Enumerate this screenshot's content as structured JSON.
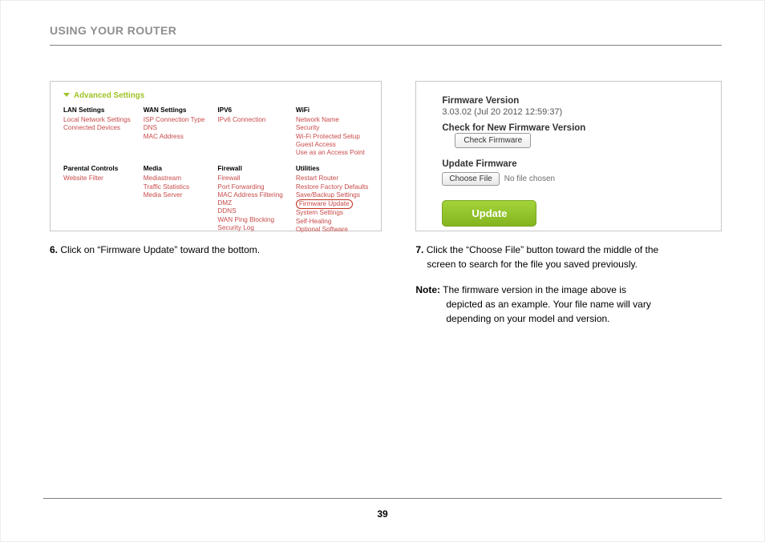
{
  "page": {
    "title": "USING YOUR ROUTER",
    "number": "39"
  },
  "shot1": {
    "title": "Advanced Settings",
    "cols": [
      {
        "head": "LAN Settings",
        "items": [
          "Local Network Settings",
          "Connected Devices"
        ]
      },
      {
        "head": "WAN Settings",
        "items": [
          "ISP Connection Type",
          "DNS",
          "MAC Address"
        ]
      },
      {
        "head": "IPV6",
        "items": [
          "IPv6 Connection"
        ]
      },
      {
        "head": "WiFi",
        "items": [
          "Network Name",
          "Security",
          "Wi-Fi Protected Setup",
          "Guest Access",
          "Use as an Access Point"
        ]
      },
      {
        "head": "Parental Controls",
        "items": [
          "Website Filter"
        ]
      },
      {
        "head": "Media",
        "items": [
          "Mediastream",
          "Traffic Statistics",
          "Media Server"
        ]
      },
      {
        "head": "Firewall",
        "items": [
          "Firewall",
          "Port Forwarding",
          "MAC Address Filtering",
          "DMZ",
          "DDNS",
          "WAN Ping Blocking",
          "Security Log"
        ]
      },
      {
        "head": "Utilities",
        "items": [
          "Restart Router",
          "Restore Factory Defaults",
          "Save/Backup Settings",
          "Firmware Update",
          "System Settings",
          "Self-Healing",
          "Optional Software"
        ],
        "highlight": "Firmware Update"
      }
    ]
  },
  "shot2": {
    "fwver_label": "Firmware Version",
    "fwver_value": "3.03.02 (Jul 20 2012 12:59:37)",
    "check_label": "Check for New Firmware Version",
    "check_btn": "Check Firmware",
    "update_label": "Update Firmware",
    "choose_btn": "Choose File",
    "nofile": "No file chosen",
    "update_btn": "Update"
  },
  "caption6": {
    "num": "6.",
    "text": "Click on “Firmware Update” toward the bottom."
  },
  "caption7": {
    "num": "7.",
    "text1": "Click the “Choose File” button toward the middle of the",
    "text2": "screen to search for the file you saved previously."
  },
  "note": {
    "label": "Note:",
    "text1": "The firmware version in the image above is",
    "text2": "depicted as an example. Your file name will vary",
    "text3": "depending on your model and version."
  }
}
